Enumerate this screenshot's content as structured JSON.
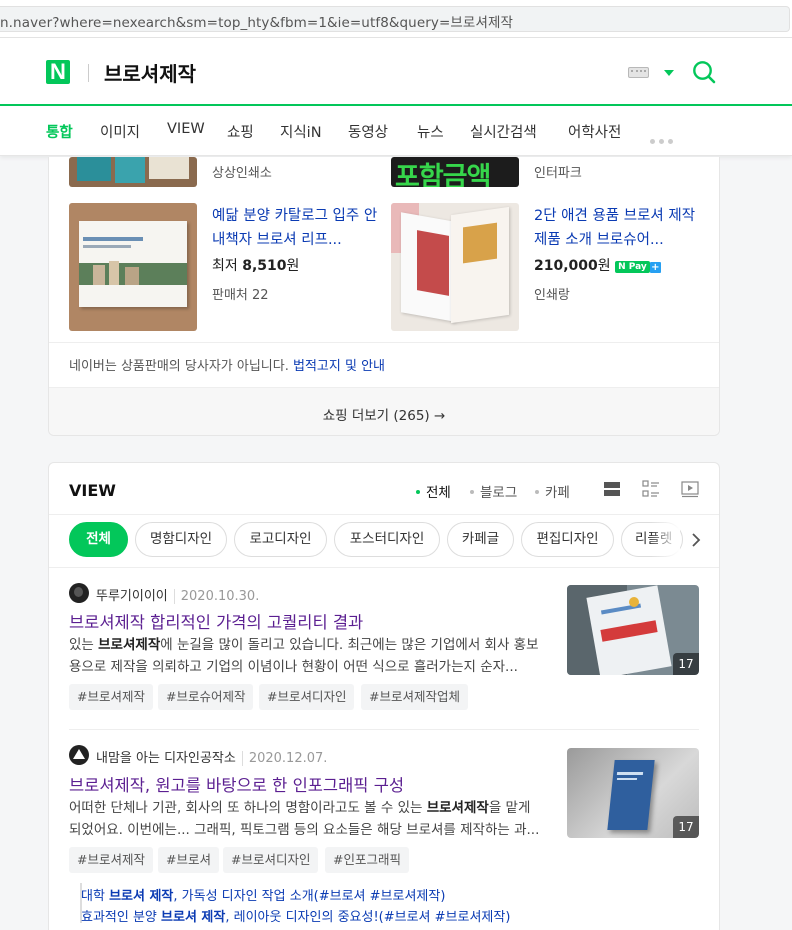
{
  "browser": {
    "url": "n.naver?where=nexearch&sm=top_hty&fbm=1&ie=utf8&query=브로셔제작"
  },
  "header": {
    "logo": "N",
    "query": "브로셔제작"
  },
  "tabs": [
    "통합",
    "이미지",
    "VIEW",
    "쇼핑",
    "지식iN",
    "동영상",
    "뉴스",
    "실시간검색",
    "어학사전"
  ],
  "shopping": {
    "top_sellers": [
      "상상인쇄소",
      "인터파크"
    ],
    "top_banner_text": "포함금액",
    "items": [
      {
        "title": "예닮 분양 카탈로그 입주 안내책자 브로셔 리프...",
        "price_prefix": "최저",
        "price": "8,510",
        "unit": "원",
        "seller": "판매처 22"
      },
      {
        "title": "2단 애견 용품 브로셔 제작 제품 소개 브로슈어...",
        "price": "210,000",
        "unit": "원",
        "npay": "N Pay",
        "npay_plus": "+",
        "seller": "인쇄랑"
      }
    ],
    "notice": "네이버는 상품판매의 당사자가 아닙니다.",
    "notice_link": "법적고지 및 안내",
    "more": "쇼핑 더보기 (265)",
    "more_arrow": "→"
  },
  "view": {
    "title": "VIEW",
    "filters": [
      "전체",
      "블로그",
      "카페"
    ],
    "chips": [
      "전체",
      "명함디자인",
      "로고디자인",
      "포스터디자인",
      "카페글",
      "편집디자인",
      "리플렛"
    ],
    "posts": [
      {
        "author": "뚜루기이이이",
        "date": "2020.10.30.",
        "title_bold": "브로셔제작",
        "title_rest": " 합리적인 가격의 고퀄리티 결과",
        "desc_1": "있는 ",
        "desc_bold": "브로셔제작",
        "desc_2": "에 눈길을 많이 돌리고 있습니다. 최근에는 많은 기업에서 회사 홍보용으로 제작을 의뢰하고 기업의 이념이나 현황이 어떤 식으로 흘러가는지 순자...",
        "tags": [
          "#브로셔제작",
          "#브로슈어제작",
          "#브로셔디자인",
          "#브로셔제작업체"
        ],
        "count": "17"
      },
      {
        "author": "내맘을 아는 디자인공작소",
        "date": "2020.12.07.",
        "title_bold": "브로셔제작",
        "title_rest": ", 원고를 바탕으로 한 인포그래픽 구성",
        "desc_1": "어떠한 단체나 기관, 회사의 또 하나의 명함이라고도 볼 수 있는 ",
        "desc_bold": "브로셔제작",
        "desc_2": "을 맡게 되었어요. 이번에는... 그래픽, 픽토그램 등의 요소들은 해당 브로셔를 제작하는 과...",
        "tags": [
          "#브로셔제작",
          "#브로셔",
          "#브로셔디자인",
          "#인포그래픽"
        ],
        "count": "17"
      }
    ],
    "related": [
      {
        "pre": "대학 ",
        "bold": "브로셔 제작",
        "post": ", 가독성 디자인 작업 소개(#브로셔 #브로셔제작)"
      },
      {
        "pre": "효과적인 분양 ",
        "bold": "브로셔 제작",
        "post": ", 레이아웃 디자인의 중요성!(#브로셔 #브로셔제작)"
      }
    ]
  },
  "colors": {
    "naver_green": "#03c75a",
    "link_blue": "#0b3bb3",
    "visited_purple": "#5b1f91"
  }
}
